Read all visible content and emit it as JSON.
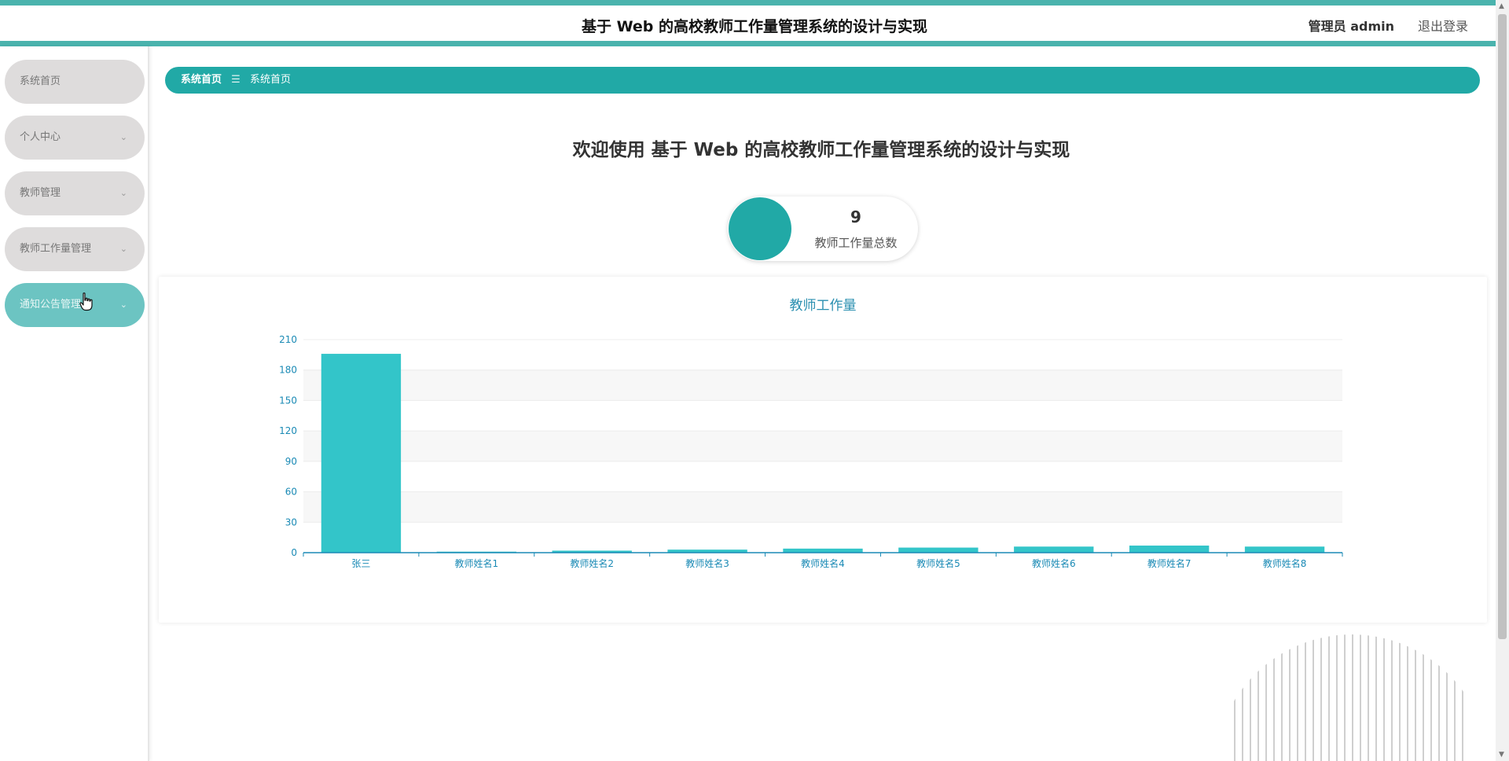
{
  "header": {
    "title": "基于 Web 的高校教师工作量管理系统的设计与实现",
    "user": "管理员 admin",
    "logout": "退出登录"
  },
  "sidebar": {
    "items": [
      {
        "label": "系统首页",
        "has_chevron": false
      },
      {
        "label": "个人中心",
        "has_chevron": true
      },
      {
        "label": "教师管理",
        "has_chevron": true
      },
      {
        "label": "教师工作量管理",
        "has_chevron": true
      },
      {
        "label": "通知公告管理",
        "has_chevron": true,
        "active": true
      }
    ],
    "chevron": "⌄"
  },
  "breadcrumb": {
    "home": "系统首页",
    "separator": "☰",
    "current": "系统首页"
  },
  "welcome": "欢迎使用 基于 Web 的高校教师工作量管理系统的设计与实现",
  "stat": {
    "value": "9",
    "label": "教师工作量总数"
  },
  "colors": {
    "accent": "#21a9a6",
    "bar": "#33c5c9",
    "axis": "#1a8ab5"
  },
  "icons": {
    "chevron": "chevron-down-icon",
    "cursor": "hand-pointer-icon",
    "scroll_up": "scroll-up-arrow-icon",
    "scroll_down": "scroll-down-arrow-icon"
  },
  "chart_data": {
    "type": "bar",
    "title": "教师工作量",
    "xlabel": "",
    "ylabel": "",
    "categories": [
      "张三",
      "教师姓名1",
      "教师姓名2",
      "教师姓名3",
      "教师姓名4",
      "教师姓名5",
      "教师姓名6",
      "教师姓名7",
      "教师姓名8"
    ],
    "values": [
      196,
      1,
      2,
      3,
      4,
      5,
      6,
      7,
      6
    ],
    "ylim": [
      0,
      210
    ],
    "yticks": [
      0,
      30,
      60,
      90,
      120,
      150,
      180,
      210
    ],
    "grid": true
  }
}
